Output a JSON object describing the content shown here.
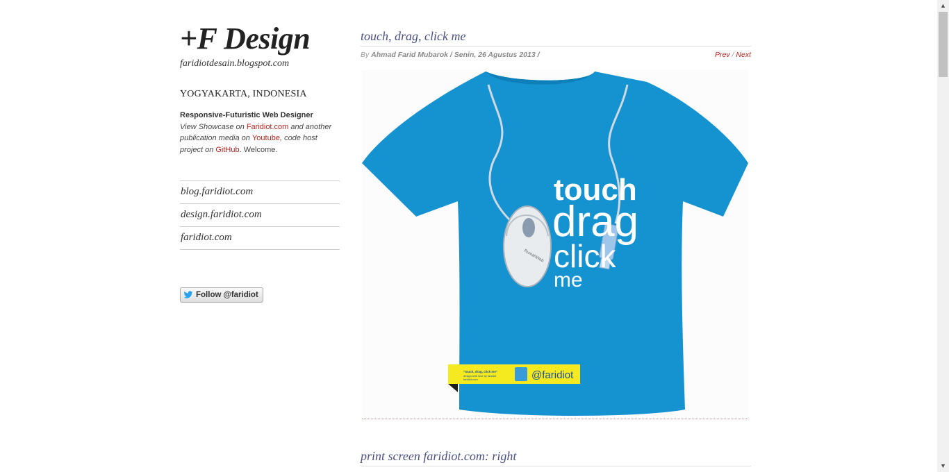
{
  "sidebar": {
    "site_title": "+F Design",
    "site_subtitle": "faridiotdesain.blogspot.com",
    "location": "YOGYAKARTA, INDONESIA",
    "role": "Responsive-Futuristic Web Designer",
    "desc_1": "View Showcase on ",
    "link_faridiot": "Faridiot.com",
    "desc_2": " and another publication media on ",
    "link_youtube": "Youtube",
    "desc_3": ", code host project on ",
    "link_github": "GitHub",
    "desc_4": ". Welcome.",
    "links": [
      {
        "label": "blog.faridiot.com"
      },
      {
        "label": "design.faridiot.com"
      },
      {
        "label": "faridiot.com"
      }
    ],
    "follow_label": "Follow @faridiot"
  },
  "post": {
    "title": "touch, drag, click me",
    "by": "By ",
    "author_date": "Ahmad Farid Mubarok / Senin, 26 Agustus 2013 /",
    "prev": "Prev",
    "sep": " / ",
    "next": "Next",
    "shirt": {
      "line1": "touch",
      "line2": "drag",
      "line3": "click",
      "line4": "me",
      "mouse_brand": "RumahWeb",
      "tag_title": "\"touch, drag, click me\"",
      "tag_line2": "design with love by faridiot",
      "tag_line3": "faridiot.com",
      "tag_handle": "@faridiot"
    },
    "colors": {
      "shirt": "#1592d0",
      "tag": "#f4ea1f",
      "accent_link": "#b3261e"
    }
  },
  "post2": {
    "title": "print screen faridiot.com: right"
  }
}
